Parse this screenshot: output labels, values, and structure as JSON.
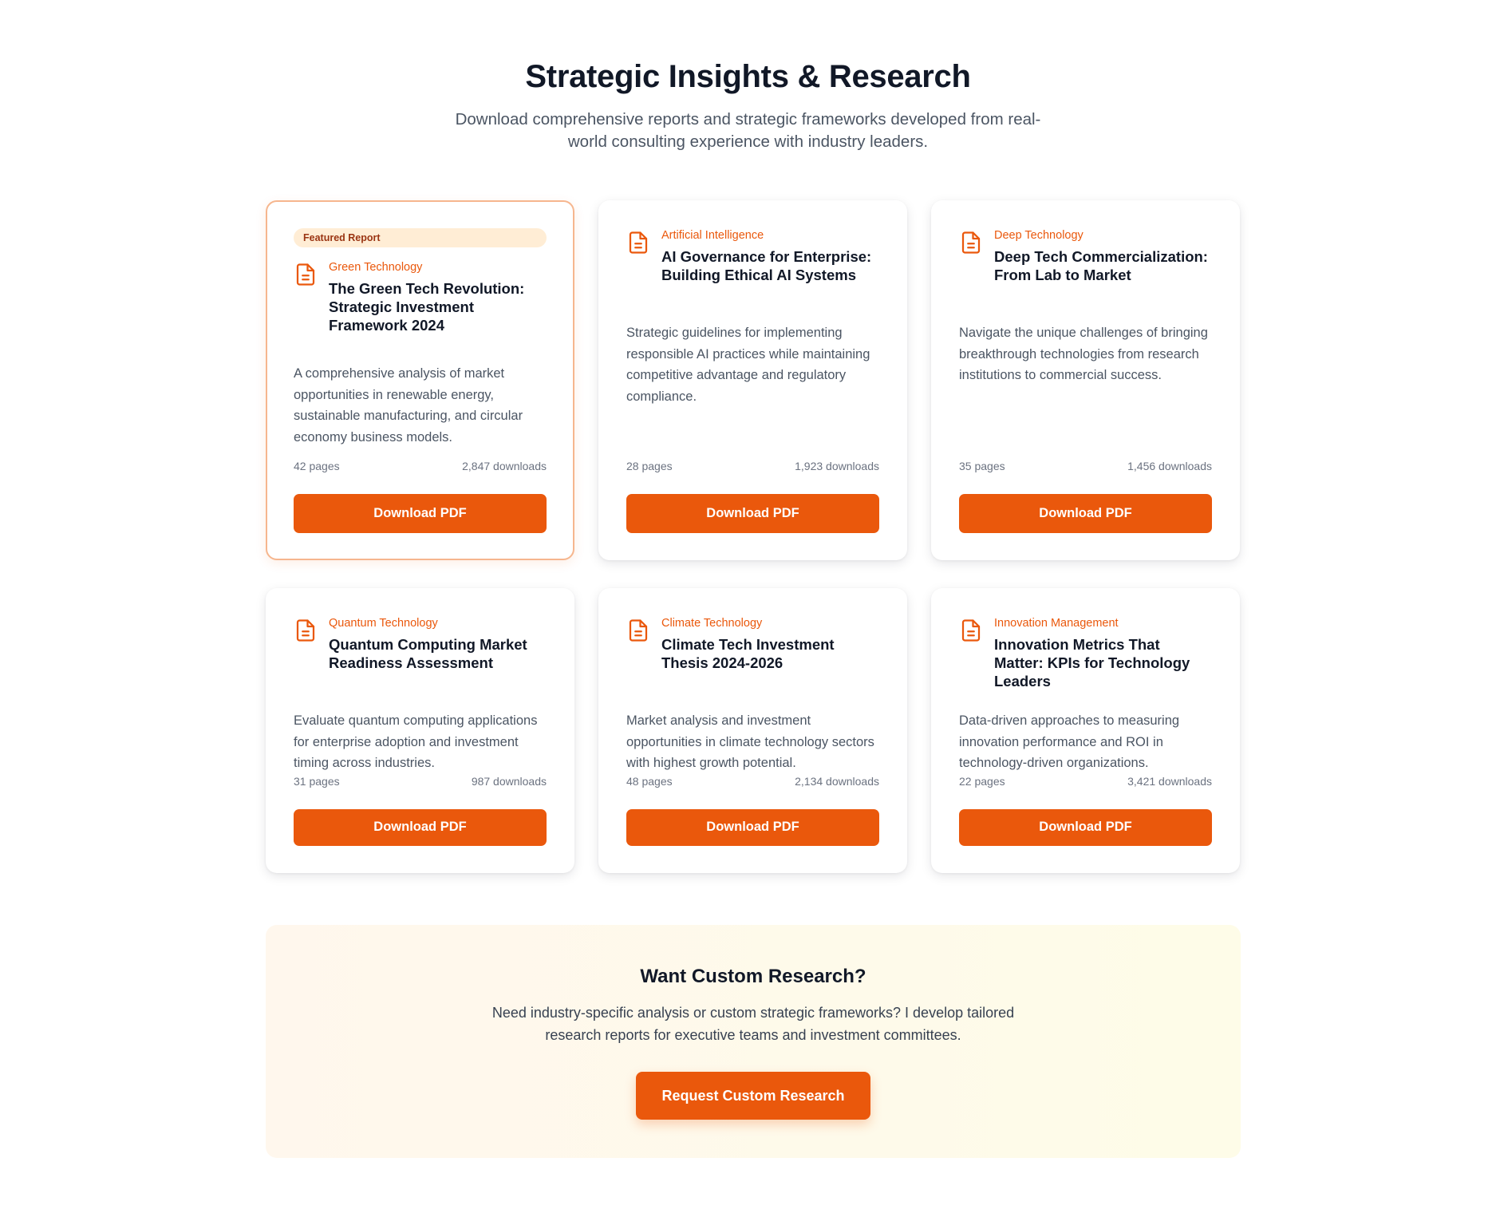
{
  "header": {
    "title": "Strategic Insights & Research",
    "subtitle": "Download comprehensive reports and strategic frameworks developed from real-world consulting experience with industry leaders."
  },
  "colors": {
    "accent": "#ea580c",
    "featured_border": "#f6b68e",
    "badge_bg": "#ffedd5",
    "badge_text": "#9a3412"
  },
  "reports": [
    {
      "featured_label": "Featured Report",
      "icon": "document-icon",
      "category": "Green Technology",
      "title": "The Green Tech Revolution: Strategic Investment Framework 2024",
      "description": "A comprehensive analysis of market opportunities in renewable energy, sustainable manufacturing, and circular economy business models.",
      "pages": "42 pages",
      "downloads": "2,847 downloads",
      "button_label": "Download PDF"
    },
    {
      "icon": "document-icon",
      "category": "Artificial Intelligence",
      "title": "AI Governance for Enterprise: Building Ethical AI Systems",
      "description": "Strategic guidelines for implementing responsible AI practices while maintaining competitive advantage and regulatory compliance.",
      "pages": "28 pages",
      "downloads": "1,923 downloads",
      "button_label": "Download PDF"
    },
    {
      "icon": "document-icon",
      "category": "Deep Technology",
      "title": "Deep Tech Commercialization: From Lab to Market",
      "description": "Navigate the unique challenges of bringing breakthrough technologies from research institutions to commercial success.",
      "pages": "35 pages",
      "downloads": "1,456 downloads",
      "button_label": "Download PDF"
    },
    {
      "icon": "document-icon",
      "category": "Quantum Technology",
      "title": "Quantum Computing Market Readiness Assessment",
      "description": "Evaluate quantum computing applications for enterprise adoption and investment timing across industries.",
      "pages": "31 pages",
      "downloads": "987 downloads",
      "button_label": "Download PDF"
    },
    {
      "icon": "document-icon",
      "category": "Climate Technology",
      "title": "Climate Tech Investment Thesis 2024-2026",
      "description": "Market analysis and investment opportunities in climate technology sectors with highest growth potential.",
      "pages": "48 pages",
      "downloads": "2,134 downloads",
      "button_label": "Download PDF"
    },
    {
      "icon": "document-icon",
      "category": "Innovation Management",
      "title": "Innovation Metrics That Matter: KPIs for Technology Leaders",
      "description": "Data-driven approaches to measuring innovation performance and ROI in technology-driven organizations.",
      "pages": "22 pages",
      "downloads": "3,421 downloads",
      "button_label": "Download PDF"
    }
  ],
  "cta": {
    "title": "Want Custom Research?",
    "text": "Need industry-specific analysis or custom strategic frameworks? I develop tailored research reports for executive teams and investment committees.",
    "button_label": "Request Custom Research"
  }
}
